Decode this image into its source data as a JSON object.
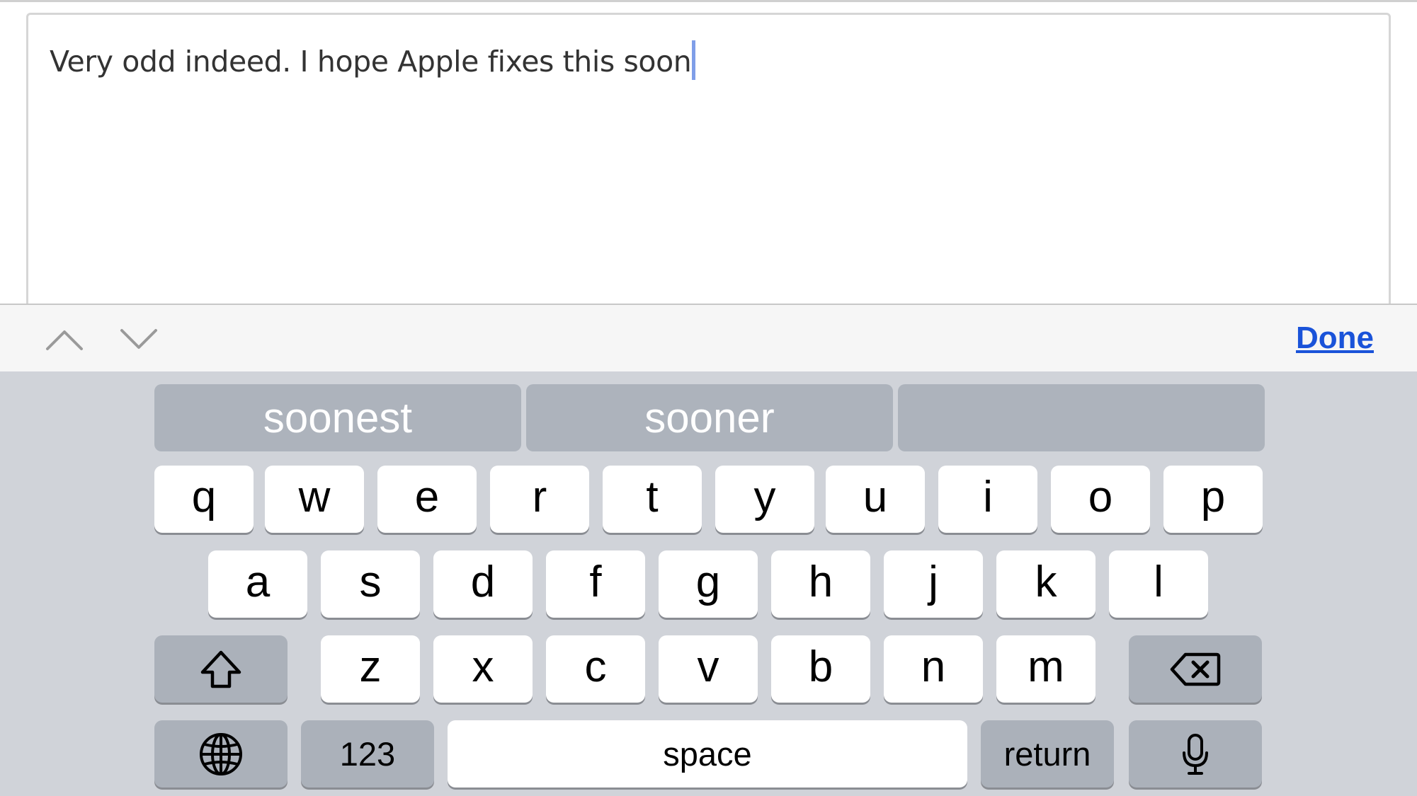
{
  "text_area": {
    "content": "Very odd indeed. I hope Apple fixes this soon"
  },
  "toolbar": {
    "prev_icon": "chevron-up-icon",
    "next_icon": "chevron-down-icon",
    "done_label": "Done",
    "accent_color": "#1a53d9"
  },
  "keyboard": {
    "suggestions": [
      "soonest",
      "sooner",
      ""
    ],
    "row1": [
      "q",
      "w",
      "e",
      "r",
      "t",
      "y",
      "u",
      "i",
      "o",
      "p"
    ],
    "row2": [
      "a",
      "s",
      "d",
      "f",
      "g",
      "h",
      "j",
      "k",
      "l"
    ],
    "row3": [
      "z",
      "x",
      "c",
      "v",
      "b",
      "n",
      "m"
    ],
    "shift_icon": "shift-arrow-icon",
    "delete_icon": "backspace-icon",
    "globe_icon": "globe-icon",
    "mic_icon": "microphone-icon",
    "numbers_label": "123",
    "space_label": "space",
    "return_label": "return"
  }
}
